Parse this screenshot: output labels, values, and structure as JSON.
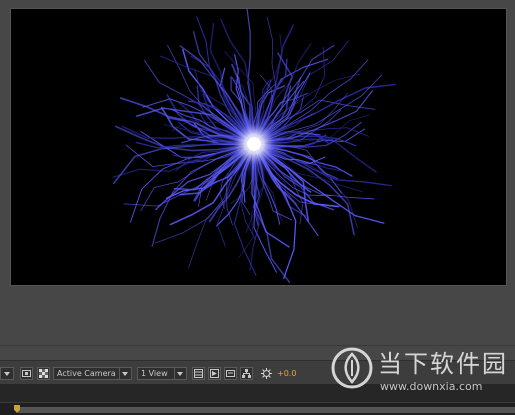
{
  "composition_viewer": {
    "content": "particle-burst-render",
    "colors": {
      "background": "#000000",
      "glow_core": "#ffffff",
      "tendril": "#5a5aff",
      "tendril_dark": "#2c2ca8"
    }
  },
  "toolbar": {
    "camera_dropdown": {
      "selected": "Active Camera"
    },
    "view_dropdown": {
      "selected": "1 View"
    },
    "exposure_value": "+0.0",
    "icons": [
      "dropdown-arrow-icon",
      "region-of-interest-icon",
      "transparency-grid-icon",
      "layout-icon",
      "fast-preview-icon",
      "timeline-icon",
      "flowchart-icon",
      "exposure-icon"
    ]
  },
  "watermark": {
    "title": "当下软件园",
    "url": "www.downxia.com"
  },
  "colors": {
    "panel": "#474747",
    "toolbar": "#3d3d3d",
    "accent": "#e0a63a",
    "timeline": "#262626"
  }
}
